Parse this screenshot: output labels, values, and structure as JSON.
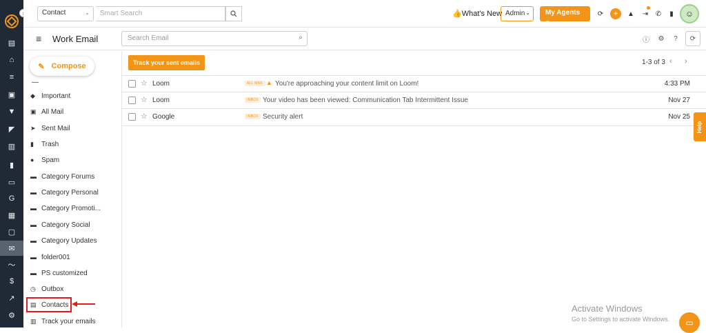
{
  "topbar": {
    "module_select": "Contact",
    "smart_search_placeholder": "Smart Search",
    "whats_new": "What's New",
    "admin": "Admin",
    "my_agents": "My Agents"
  },
  "header": {
    "title": "Work Email",
    "search_placeholder": "Search Email"
  },
  "sidebar": {
    "compose": "Compose",
    "folders": [
      {
        "label": "Important",
        "icon": "tag-icon"
      },
      {
        "label": "All Mail",
        "icon": "inbox-download-icon"
      },
      {
        "label": "Sent Mail",
        "icon": "send-icon"
      },
      {
        "label": "Trash",
        "icon": "trash-icon"
      },
      {
        "label": "Spam",
        "icon": "alert-circle-icon"
      },
      {
        "label": "Category Forums",
        "icon": "folder-icon"
      },
      {
        "label": "Category Personal",
        "icon": "folder-icon"
      },
      {
        "label": "Category Promoti...",
        "icon": "folder-icon"
      },
      {
        "label": "Category Social",
        "icon": "folder-icon"
      },
      {
        "label": "Category Updates",
        "icon": "folder-icon"
      },
      {
        "label": "folder001",
        "icon": "folder-icon"
      },
      {
        "label": "PS customized",
        "icon": "folder-icon"
      },
      {
        "label": "Outbox",
        "icon": "clock-icon"
      },
      {
        "label": "Contacts",
        "icon": "contacts-icon"
      },
      {
        "label": "Track your emails",
        "icon": "bar-chart-icon"
      }
    ]
  },
  "main": {
    "track_button": "Track your sent emails",
    "pager": "1-3 of 3",
    "emails": [
      {
        "from": "Loom",
        "badge": "ALL MAIL",
        "subject": "You're approaching your content limit on Loom!",
        "date": "4:33 PM",
        "warning": true
      },
      {
        "from": "Loom",
        "badge": "INBOX",
        "subject": "Your video has been viewed: Communication Tab Intermittent Issue",
        "date": "Nov 27",
        "warning": false
      },
      {
        "from": "Google",
        "badge": "INBOX",
        "subject": "Security alert",
        "date": "Nov 25",
        "warning": false
      }
    ]
  },
  "help_tab": "Help",
  "watermark": {
    "title": "Activate Windows",
    "subtitle": "Go to Settings to activate Windows."
  },
  "colors": {
    "accent": "#f39417",
    "rail": "#1f2a36",
    "annotation": "#e21b1b"
  }
}
